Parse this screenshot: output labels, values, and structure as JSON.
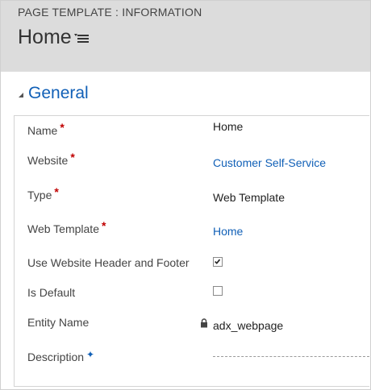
{
  "header": {
    "entity_label": "PAGE TEMPLATE : INFORMATION",
    "title": "Home"
  },
  "section": {
    "title": "General"
  },
  "fields": {
    "name": {
      "label": "Name",
      "value": "Home",
      "marker": "*"
    },
    "website": {
      "label": "Website",
      "value": "Customer Self-Service",
      "marker": "*"
    },
    "type": {
      "label": "Type",
      "value": "Web Template",
      "marker": "*"
    },
    "web_template": {
      "label": "Web Template",
      "value": "Home",
      "marker": "*"
    },
    "use_header_footer": {
      "label": "Use Website Header and Footer",
      "checked": true
    },
    "is_default": {
      "label": "Is Default",
      "checked": false
    },
    "entity_name": {
      "label": "Entity Name",
      "value": "adx_webpage"
    },
    "description": {
      "label": "Description",
      "value": "",
      "marker": "✦"
    }
  },
  "colors": {
    "header_bg": "#dcdcdc",
    "link": "#1160b7",
    "required": "#c00000"
  },
  "icons": {
    "menu": "menu-list-icon",
    "section_toggle": "collapse-triangle-icon",
    "lock": "lock-icon",
    "check": "checkmark-icon"
  }
}
